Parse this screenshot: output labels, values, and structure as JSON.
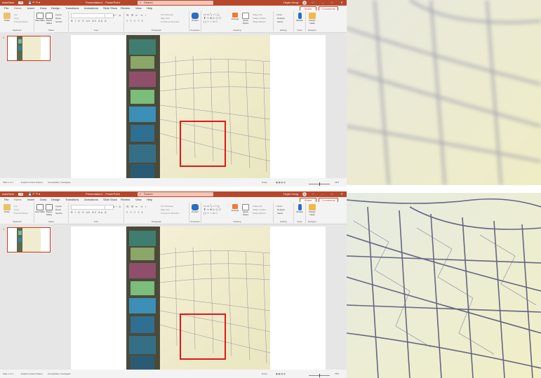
{
  "screens": [
    {
      "id": "top",
      "titlebar": {
        "autosave": "AutoSave",
        "autosave_state": "Off",
        "doc_title": "Presentation1 - PowerPoint",
        "search": "Search",
        "user": "Hoyle Hong",
        "user_initial": "H"
      },
      "tabs": [
        "File",
        "Home",
        "Insert",
        "Draw",
        "Design",
        "Transitions",
        "Animations",
        "Slide Show",
        "Review",
        "View",
        "Help"
      ],
      "share": "Share",
      "comments": "Comments",
      "ribbon": {
        "clipboard": {
          "label": "Clipboard",
          "paste": "Paste",
          "cut": "Cut",
          "copy": "Copy",
          "format_painter": "Format Painter"
        },
        "slides": {
          "label": "Slides",
          "new_slide": "New Slide",
          "reuse_slides": "Reuse Slides",
          "layout": "Layout",
          "reset": "Reset",
          "section": "Section"
        },
        "font": {
          "label": "Font",
          "size": "A^ A"
        },
        "paragraph": {
          "label": "Paragraph",
          "text_direction": "Text Direction",
          "align_text": "Align Text",
          "convert_smartart": "Convert to SmartArt"
        },
        "protection": {
          "label": "Protection",
          "protect": "Protect"
        },
        "drawing": {
          "label": "Drawing",
          "arrange": "Arrange",
          "quick_styles": "Quick Styles",
          "shape_fill": "Shape Fill",
          "shape_outline": "Shape Outline",
          "shape_effects": "Shape Effects"
        },
        "editing": {
          "label": "Editing",
          "find": "Find",
          "replace": "Replace",
          "select": "Select"
        },
        "voice": {
          "label": "Voice",
          "dictate": "Dictate"
        },
        "designer": {
          "label": "Designer",
          "design_ideas": "Design Ideas"
        }
      },
      "thumbnail_number": "1",
      "status": {
        "slide": "Slide 1 of 1",
        "language": "English (United States)",
        "accessibility": "Accessibility: Investigate",
        "notes": "Notes",
        "zoom": "78%"
      }
    },
    {
      "id": "bottom",
      "titlebar": {
        "autosave": "AutoSave",
        "autosave_state": "Off",
        "doc_title": "Presentation1 - PowerPoint",
        "search": "Search",
        "user": "Hoyle Hong",
        "user_initial": "H"
      },
      "tabs": [
        "File",
        "Home",
        "Insert",
        "Draw",
        "Design",
        "Transitions",
        "Animations",
        "Slide Show",
        "Review",
        "View",
        "Help"
      ],
      "share": "Share",
      "comments": "Comments",
      "ribbon": {
        "clipboard": {
          "label": "Clipboard",
          "paste": "Paste",
          "cut": "Cut",
          "copy": "Copy",
          "format_painter": "Format Painter"
        },
        "slides": {
          "label": "Slides",
          "new_slide": "New Slide",
          "reuse_slides": "Reuse Slides",
          "layout": "Layout",
          "reset": "Reset",
          "section": "Section"
        },
        "font": {
          "label": "Font",
          "size": "A^ A"
        },
        "paragraph": {
          "label": "Paragraph",
          "text_direction": "Text Direction",
          "align_text": "Align Text",
          "convert_smartart": "Convert to SmartArt"
        },
        "protection": {
          "label": "Protection",
          "protect": "Protect"
        },
        "drawing": {
          "label": "Drawing",
          "arrange": "Arrange",
          "quick_styles": "Quick Styles",
          "shape_fill": "Shape Fill",
          "shape_outline": "Shape Outline",
          "shape_effects": "Shape Effects"
        },
        "editing": {
          "label": "Editing",
          "find": "Find",
          "replace": "Replace",
          "select": "Select"
        },
        "voice": {
          "label": "Voice",
          "dictate": "Dictate"
        },
        "designer": {
          "label": "Designer",
          "design_ideas": "Design Ideas"
        }
      },
      "thumbnail_number": "1",
      "status": {
        "slide": "Slide 1 of 1",
        "language": "English (United States)",
        "accessibility": "Accessibility: Investigate",
        "notes": "Notes",
        "zoom": "78%"
      }
    }
  ],
  "colors": {
    "accent": "#b7472a",
    "highlight_box": "#e2161a"
  },
  "icons": [
    "paste-icon",
    "new-slide-icon",
    "protect-icon",
    "shapes-gallery-icon",
    "arrange-icon",
    "find-icon",
    "dictate-icon",
    "design-ideas-icon",
    "search-icon",
    "zoom-slider-icon"
  ]
}
